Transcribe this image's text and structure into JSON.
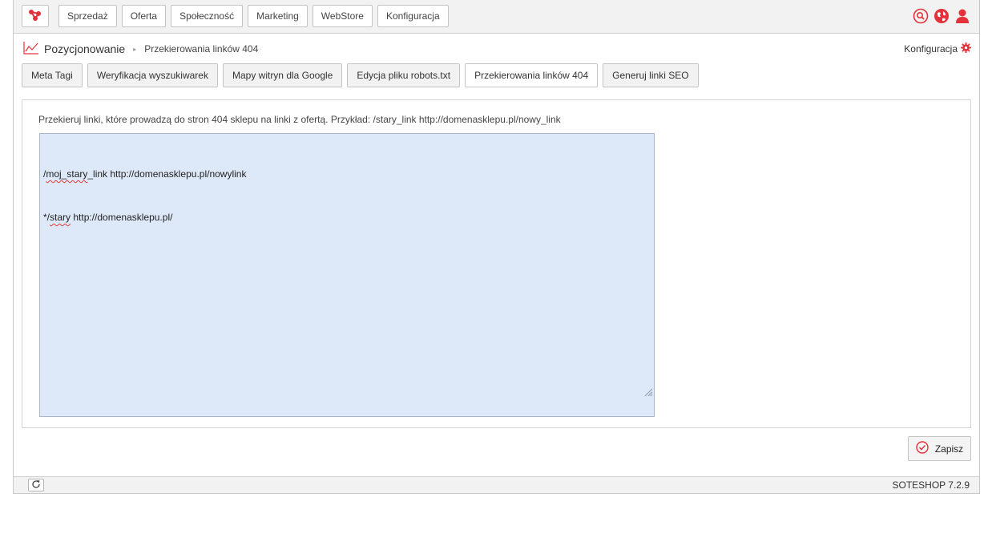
{
  "colors": {
    "accent": "#e3323a",
    "editor_bg": "#dde8f8"
  },
  "topbar": {
    "logo_icon": "share-nodes-icon",
    "menu": [
      {
        "label": "Sprzedaż"
      },
      {
        "label": "Oferta"
      },
      {
        "label": "Społeczność"
      },
      {
        "label": "Marketing"
      },
      {
        "label": "WebStore"
      },
      {
        "label": "Konfiguracja"
      }
    ],
    "icons": [
      "search-icon",
      "globe-icon",
      "user-icon"
    ]
  },
  "breadcrumb": {
    "icon": "chart-line-icon",
    "title": "Pozycjonowanie",
    "separator": "▸",
    "current": "Przekierowania linków 404"
  },
  "config_link": {
    "label": "Konfiguracja",
    "icon": "gear-icon"
  },
  "tabs": [
    {
      "label": "Meta Tagi",
      "active": false
    },
    {
      "label": "Weryfikacja wyszukiwarek",
      "active": false
    },
    {
      "label": "Mapy witryn dla Google",
      "active": false
    },
    {
      "label": "Edycja pliku robots.txt",
      "active": false
    },
    {
      "label": "Przekierowania linków 404",
      "active": true
    },
    {
      "label": "Generuj linki SEO",
      "active": false
    }
  ],
  "panel": {
    "hint": "Przekieruj linki, które prowadzą do stron 404 sklepu na linki z ofertą. Przykład: /stary_link http://domenasklepu.pl/nowy_link",
    "editor_lines": [
      {
        "prefix": "/",
        "misspelled": "moj_stary",
        "rest": "_link http://domenasklepu.pl/nowylink"
      },
      {
        "prefix": "*/",
        "misspelled": "stary",
        "rest": " http://domenasklepu.pl/"
      }
    ]
  },
  "save_button": {
    "label": "Zapisz",
    "icon": "check-circle-icon"
  },
  "footer": {
    "refresh_icon": "refresh-icon",
    "version": "SOTESHOP 7.2.9"
  }
}
